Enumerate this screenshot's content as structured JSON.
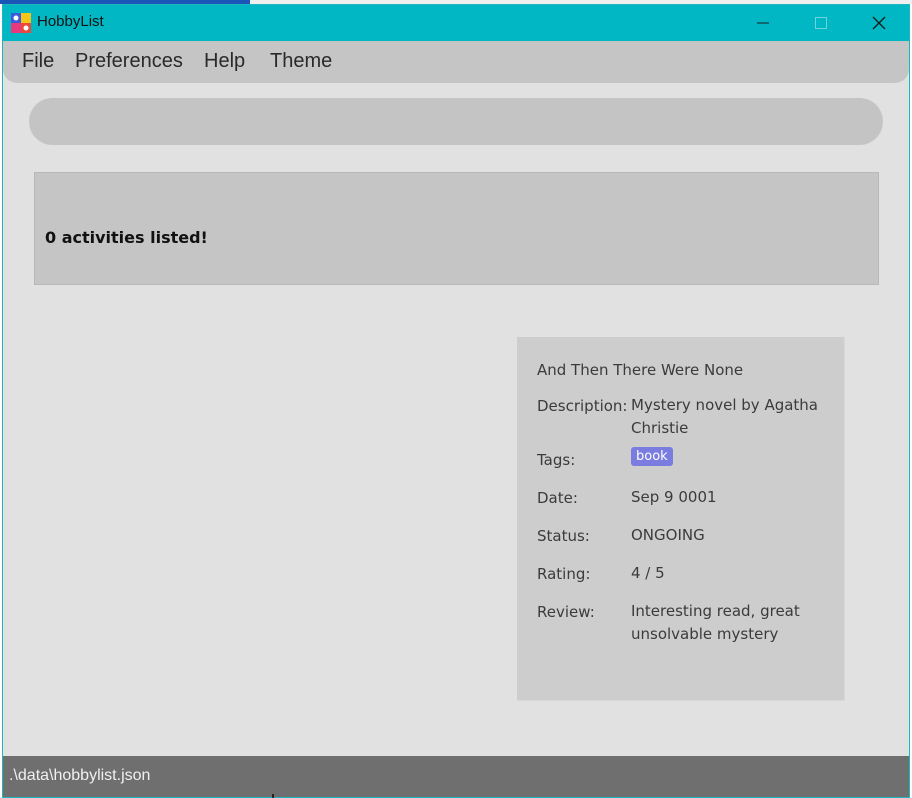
{
  "window": {
    "title": "HobbyList",
    "titlebar_color": "#00b7c3"
  },
  "menu": {
    "items": [
      {
        "label": "File"
      },
      {
        "label": "Preferences"
      },
      {
        "label": "Help"
      },
      {
        "label": "Theme"
      }
    ]
  },
  "command_box": {
    "value": "",
    "placeholder": ""
  },
  "result": {
    "message": "0 activities listed!"
  },
  "activity": {
    "name": "And Then There Were None",
    "description_label": "Description:",
    "description": "Mystery novel by Agatha Christie",
    "tags_label": "Tags:",
    "tags": [
      "book"
    ],
    "tag_color": "#7a7ce0",
    "date_label": "Date:",
    "date": "Sep 9 0001",
    "status_label": "Status:",
    "status": "ONGOING",
    "rating_label": "Rating:",
    "rating": "4 / 5",
    "review_label": "Review:",
    "review": "Interesting read, great unsolvable mystery"
  },
  "statusbar": {
    "path": ".\\data\\hobbylist.json"
  }
}
